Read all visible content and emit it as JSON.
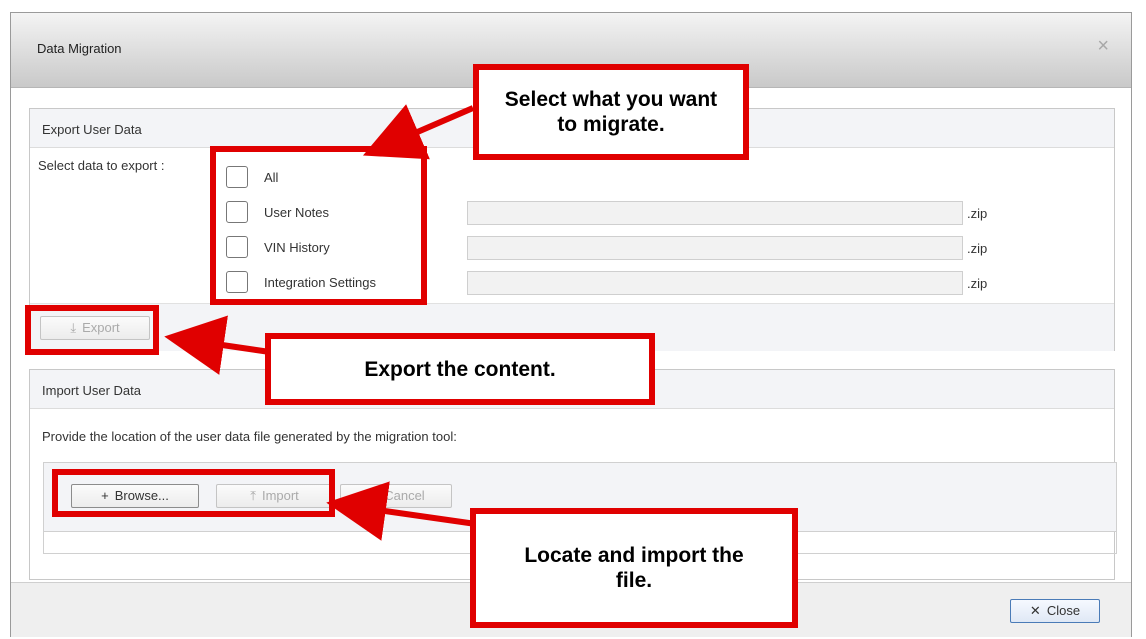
{
  "dialog": {
    "title": "Data Migration",
    "close_glyph": "×",
    "close_icon": "close-icon"
  },
  "export": {
    "header": "Export User Data",
    "select_label": "Select data to export :",
    "options": [
      {
        "label": "All",
        "checked": false
      },
      {
        "label": "User Notes",
        "checked": false,
        "value": "",
        "ext": ".zip"
      },
      {
        "label": "VIN History",
        "checked": false,
        "value": "",
        "ext": ".zip"
      },
      {
        "label": "Integration Settings",
        "checked": false,
        "value": "",
        "ext": ".zip"
      }
    ],
    "export_button": "Export",
    "export_icon": "download-icon"
  },
  "import": {
    "header": "Import User Data",
    "instruction": "Provide the location of the user data file generated by the migration tool:",
    "browse_button": "Browse...",
    "import_button": "Import",
    "cancel_button": "Cancel"
  },
  "footer": {
    "close_button": "Close"
  },
  "annotations": {
    "select": "Select what you want to migrate.",
    "export": "Export the content.",
    "import": "Locate and import the file.",
    "color": "#e00000"
  }
}
